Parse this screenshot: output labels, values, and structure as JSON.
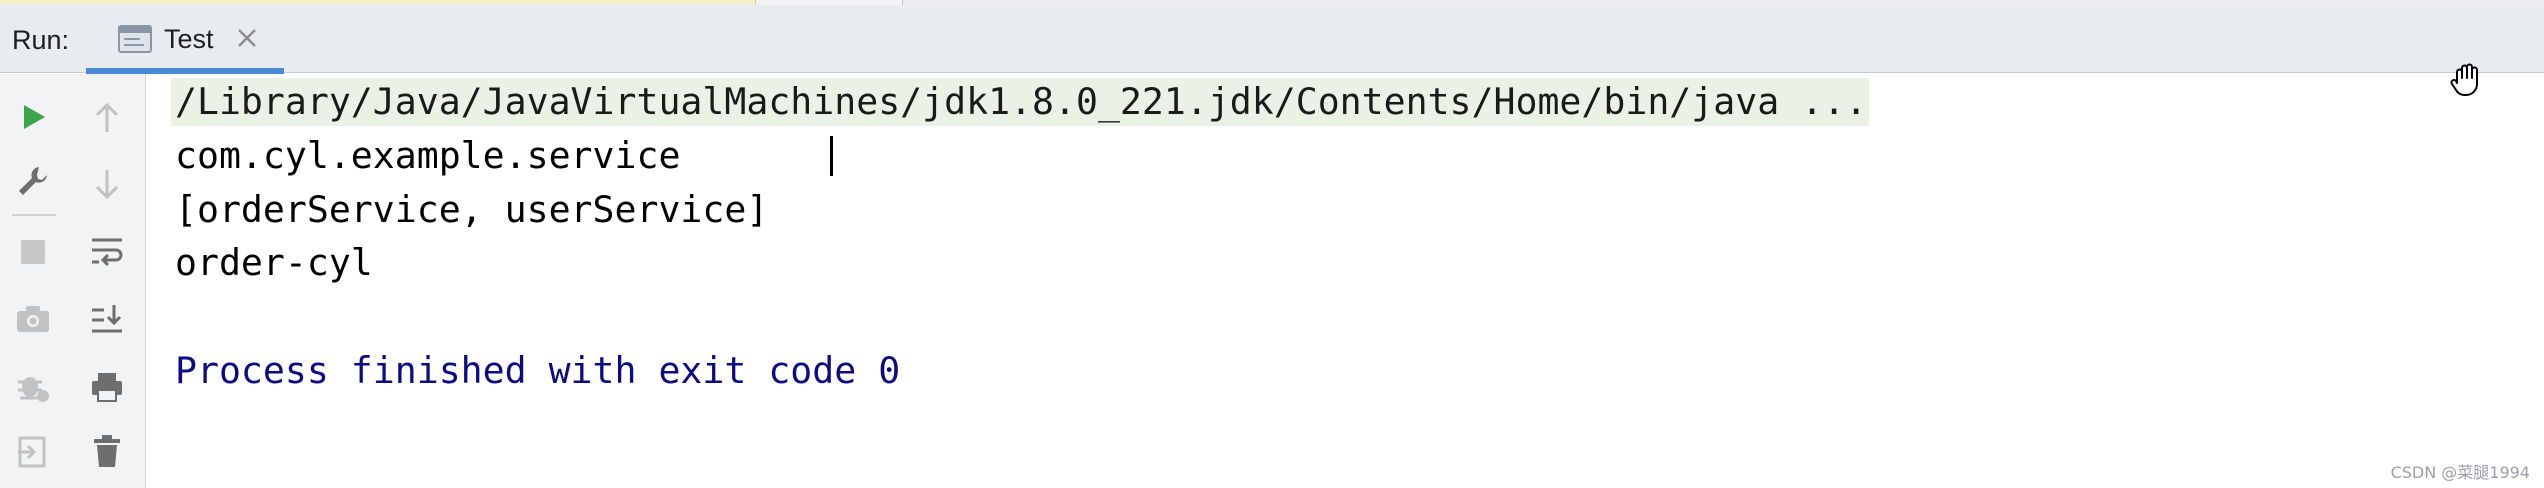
{
  "header": {
    "run_label": "Run:",
    "tab_label": "Test"
  },
  "console": {
    "command": "/Library/Java/JavaVirtualMachines/jdk1.8.0_221.jdk/Contents/Home/bin/java ...",
    "output_lines": [
      "com.cyl.example.service",
      "[orderService, userService]",
      "order-cyl"
    ],
    "exit_message": "Process finished with exit code 0"
  },
  "toolbar": {
    "left_column": [
      "rerun-icon",
      "settings-wrench-icon",
      "stop-icon",
      "camera-icon",
      "debug-bug-icon",
      "exit-icon"
    ],
    "right_column": [
      "up-arrow-icon",
      "down-arrow-icon",
      "soft-wrap-icon",
      "scroll-to-end-icon",
      "print-icon",
      "trash-icon"
    ]
  },
  "colors": {
    "accent": "#4b8bd6",
    "run_green": "#3aa54a",
    "exit_text": "#0b0b86",
    "command_bg": "#eaf2e6"
  },
  "watermark": "CSDN @菜腿1994"
}
